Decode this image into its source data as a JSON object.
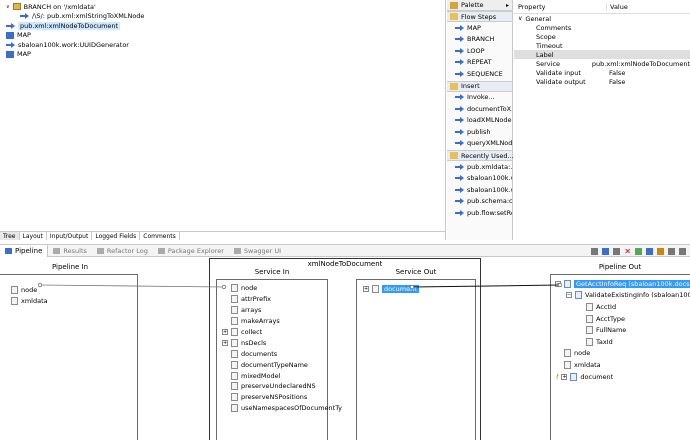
{
  "flow_tree": [
    {
      "label": "BRANCH on '/xmldata'",
      "indent": 0,
      "icon": "branch",
      "expander": "v"
    },
    {
      "label": "/\\S/: pub.xml:xmlStringToXMLNode",
      "indent": 1,
      "icon": "invoke"
    },
    {
      "label": "pub.xml:xmlNodeToDocument",
      "indent": 0,
      "icon": "invoke",
      "selected": true
    },
    {
      "label": "MAP",
      "indent": 0,
      "icon": "map"
    },
    {
      "label": "sbaloan100k.work:UUIDGenerator",
      "indent": 0,
      "icon": "invoke"
    },
    {
      "label": "MAP",
      "indent": 0,
      "icon": "map"
    }
  ],
  "editor_tabs": [
    "Tree",
    "Layout",
    "Input/Output",
    "Logged Fields",
    "Comments"
  ],
  "palette": {
    "title": "Palette",
    "sections": [
      {
        "title": "Flow Steps",
        "items": [
          "MAP",
          "BRANCH",
          "LOOP",
          "REPEAT",
          "SEQUENCE"
        ]
      },
      {
        "title": "Insert",
        "items": [
          "Invoke...",
          "documentToX...",
          "loadXMLNode",
          "publish",
          "queryXMLNode"
        ]
      },
      {
        "title": "Recently Used...",
        "items": [
          "pub.xmldata:...",
          "sbaloan100k.w...",
          "sbaloan100k.w...",
          "pub.schema:cr...",
          "pub.flow:setRe..."
        ]
      }
    ]
  },
  "properties": {
    "col_property": "Property",
    "col_value": "Value",
    "group": "General",
    "rows": [
      {
        "name": "Comments",
        "value": ""
      },
      {
        "name": "Scope",
        "value": ""
      },
      {
        "name": "Timeout",
        "value": ""
      },
      {
        "name": "Label",
        "value": "",
        "highlight": true
      },
      {
        "name": "Service",
        "value": "pub.xml:xmlNodeToDocument"
      },
      {
        "name": "Validate input",
        "value": "False"
      },
      {
        "name": "Validate output",
        "value": "False"
      }
    ]
  },
  "bottom_tabs": [
    "Pipeline",
    "Results",
    "Refactor Log",
    "Package Explorer",
    "Swagger UI"
  ],
  "pipeline": {
    "pipeline_in_title": "Pipeline In",
    "pipeline_in_items": [
      "node",
      "xmldata"
    ],
    "service_title": "xmlNodeToDocument",
    "service_in_title": "Service In",
    "service_in_items": [
      {
        "label": "node",
        "type": "doc"
      },
      {
        "label": "attrPrefix",
        "type": "doc"
      },
      {
        "label": "arrays",
        "type": "doc"
      },
      {
        "label": "makeArrays",
        "type": "doc"
      },
      {
        "label": "collect",
        "type": "expand"
      },
      {
        "label": "nsDecls",
        "type": "expand"
      },
      {
        "label": "documents",
        "type": "doc"
      },
      {
        "label": "documentTypeName",
        "type": "doc"
      },
      {
        "label": "mixedModel",
        "type": "doc"
      },
      {
        "label": "preserveUndeclaredNS",
        "type": "doc"
      },
      {
        "label": "preserveNSPositions",
        "type": "doc"
      },
      {
        "label": "useNamespacesOfDocumentTy",
        "type": "doc"
      }
    ],
    "service_out_title": "Service Out",
    "service_out_items": [
      "document"
    ],
    "pipeline_out_title": "Pipeline Out",
    "pipeline_out_items": [
      {
        "label": "GetAcctInfoReq (sbaloan100k.docs:reque",
        "indent": 0,
        "type": "expand",
        "selected": true
      },
      {
        "label": "ValidateExistingInfo (sbaloan100k.do",
        "indent": 1,
        "type": "expand"
      },
      {
        "label": "AcctId",
        "indent": 2,
        "type": "doc"
      },
      {
        "label": "AcctType",
        "indent": 2,
        "type": "doc"
      },
      {
        "label": "FullName",
        "indent": 2,
        "type": "doc"
      },
      {
        "label": "TaxId",
        "indent": 2,
        "type": "doc"
      },
      {
        "label": "node",
        "indent": 0,
        "type": "doc"
      },
      {
        "label": "xmldata",
        "indent": 0,
        "type": "doc"
      },
      {
        "label": "document",
        "indent": 0,
        "type": "expand-key"
      }
    ]
  },
  "colors": {
    "selection": "#3399ff",
    "accent": "#3b6ec9",
    "map_link": "#000000"
  }
}
